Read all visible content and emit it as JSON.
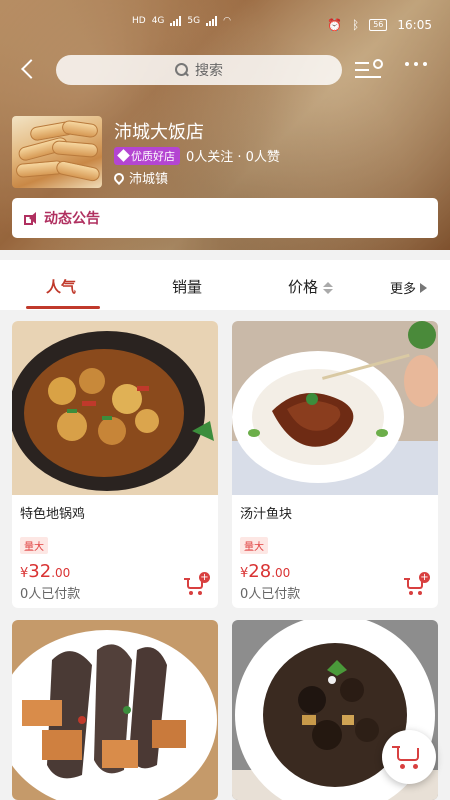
{
  "status_bar": {
    "left_text_1": "HD",
    "left_text_2": "4G",
    "network_2": "5G",
    "battery": "56",
    "time": "16:05"
  },
  "header": {
    "search_placeholder": "搜索"
  },
  "store": {
    "name": "沛城大饭店",
    "quality_badge": "优质好店",
    "stats": "0人关注 · 0人赞",
    "location": "沛城镇"
  },
  "notice": {
    "label": "动态公告"
  },
  "tabs": [
    {
      "label": "人气"
    },
    {
      "label": "销量"
    },
    {
      "label": "价格"
    },
    {
      "label": "更多"
    }
  ],
  "products": [
    {
      "title": "特色地锅鸡",
      "tag": "量大",
      "currency": "¥",
      "price_int": "32",
      "price_dec": ".00",
      "paid": "0人已付款"
    },
    {
      "title": "汤汁鱼块",
      "tag": "量大",
      "currency": "¥",
      "price_int": "28",
      "price_dec": ".00",
      "paid": "0人已付款"
    },
    {
      "title": "",
      "tag": "",
      "currency": "",
      "price_int": "",
      "price_dec": "",
      "paid": ""
    },
    {
      "title": "",
      "tag": "",
      "currency": "",
      "price_int": "",
      "price_dec": "",
      "paid": ""
    }
  ],
  "colors": {
    "accent": "#c0392b",
    "notice": "#b03060",
    "quality_badge": "#b445d2",
    "price": "#d93333"
  },
  "icons": {
    "back": "back-arrow-icon",
    "search": "search-icon",
    "list_search": "list-search-icon",
    "more": "more-dots-icon",
    "cart": "cart-icon"
  }
}
